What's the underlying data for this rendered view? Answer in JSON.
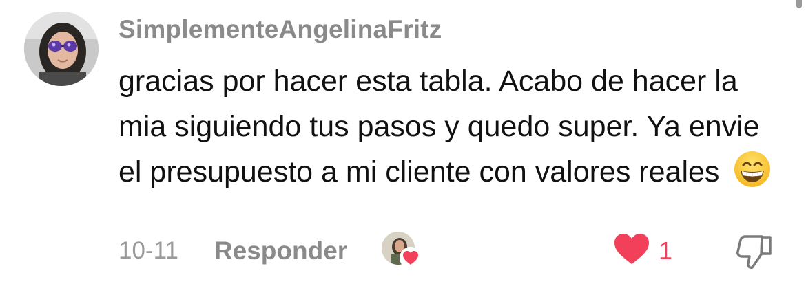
{
  "comment": {
    "username": "SimplementeAngelinaFritz",
    "text": "gracias por hacer esta tabla. Acabo de hacer la mia siguiendo tus pasos y quedo super. Ya envie el presupuesto a mi cliente con valores reales",
    "emoji": "grinning-face-with-smiling-eyes",
    "date": "10-11",
    "reply_label": "Responder",
    "like_count": "1",
    "liked_by_creator": true
  },
  "colors": {
    "username": "#8a8a8a",
    "text": "#111111",
    "meta": "#9a9a9a",
    "like_red": "#f2405b"
  },
  "icons": {
    "like": "heart-icon",
    "dislike": "thumbs-down-icon",
    "creator_heart": "heart-icon"
  }
}
